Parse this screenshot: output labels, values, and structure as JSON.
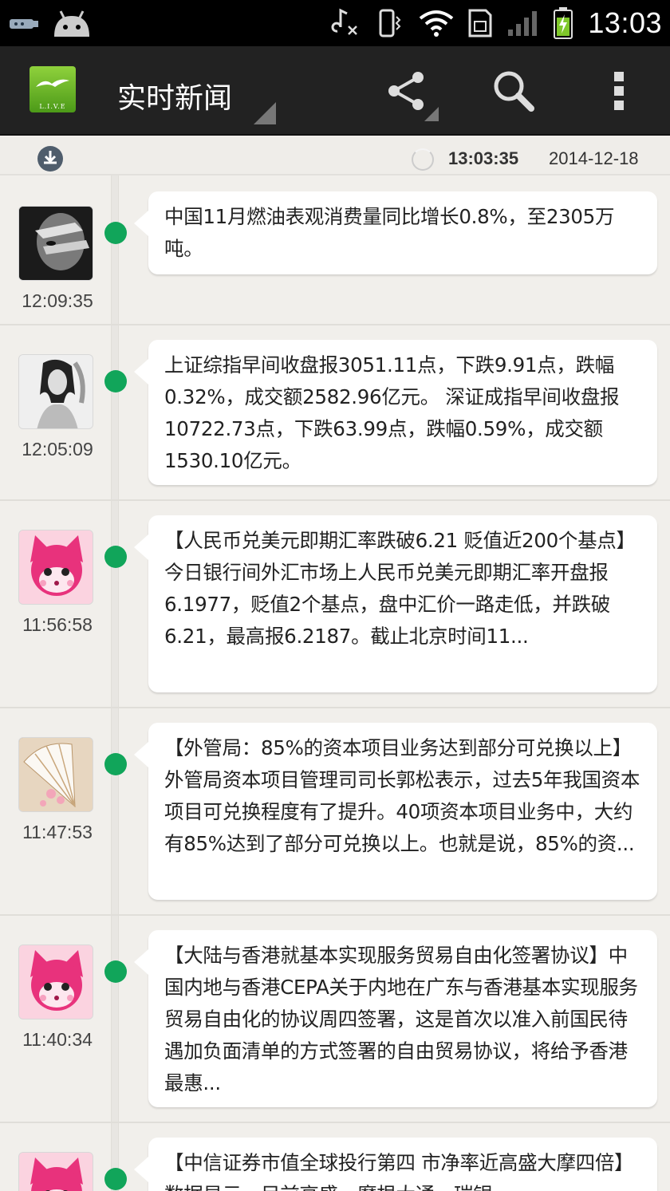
{
  "status_bar": {
    "time": "13:03",
    "icons": [
      "usb-icon",
      "android-icon",
      "music-muted-icon",
      "vibrate-icon",
      "wifi-icon",
      "sim-icon",
      "signal-icon",
      "battery-charging-icon"
    ]
  },
  "action_bar": {
    "title": "实时新闻",
    "logo_text": "L.I.V.E",
    "actions": [
      "share-icon",
      "search-icon",
      "overflow-menu-icon"
    ]
  },
  "sub_header": {
    "refresh_time": "13:03:35",
    "date": "2014-12-18"
  },
  "colors": {
    "accent_dot": "#11a55a",
    "action_bar_bg": "#222222",
    "page_bg": "#f1efeb"
  },
  "news": [
    {
      "time": "12:09:35",
      "avatar": "bw-face-avatar",
      "text": "中国11月燃油表观消费量同比增长0.8%，至2305万吨。"
    },
    {
      "time": "12:05:09",
      "avatar": "bw-girl-avatar",
      "text": "上证综指早间收盘报3051.11点，下跌9.91点，跌幅0.32%，成交额2582.96亿元。 深证成指早间收盘报10722.73点，下跌63.99点，跌幅0.59%，成交额1530.10亿元。"
    },
    {
      "time": "11:56:58",
      "avatar": "pink-fox-avatar",
      "text": "【人民币兑美元即期汇率跌破6.21 贬值近200个基点】今日银行间外汇市场上人民币兑美元即期汇率开盘报6.1977，贬值2个基点，盘中汇价一路走低，并跌破6.21，最高报6.2187。截止北京时间11..."
    },
    {
      "time": "11:47:53",
      "avatar": "fan-avatar",
      "text": "【外管局：85%的资本项目业务达到部分可兑换以上】外管局资本项目管理司司长郭松表示，过去5年我国资本项目可兑换程度有了提升。40项资本项目业务中，大约有85%达到了部分可兑换以上。也就是说，85%的资..."
    },
    {
      "time": "11:40:34",
      "avatar": "pink-fox-avatar",
      "text": "【大陆与香港就基本实现服务贸易自由化签署协议】中国内地与香港CEPA关于内地在广东与香港基本实现服务贸易自由化的协议周四签署，这是首次以准入前国民待遇加负面清单的方式签署的自由贸易协议，将给予香港最惠..."
    },
    {
      "time": "",
      "avatar": "pink-fox-avatar",
      "text": "【中信证券市值全球投行第四 市净率近高盛大摩四倍】数据显示，目前高盛、摩根大通、瑞银"
    }
  ]
}
